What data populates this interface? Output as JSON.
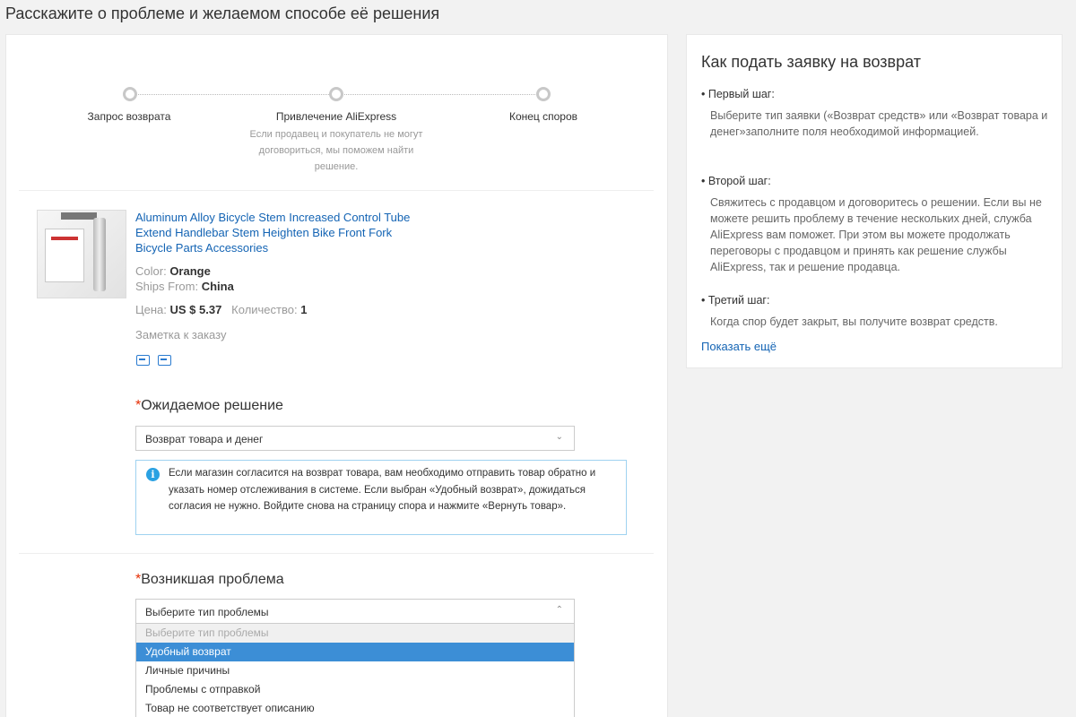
{
  "page": {
    "title": "Расскажите о проблеме и желаемом способе её решения"
  },
  "progress": {
    "steps": [
      {
        "label": "Запрос возврата",
        "desc": ""
      },
      {
        "label": "Привлечение AliExpress",
        "desc": "Если продавец и покупатель не могут договориться, мы поможем найти решение."
      },
      {
        "label": "Конец споров",
        "desc": ""
      }
    ]
  },
  "product": {
    "title": "Aluminum Alloy Bicycle Stem Increased Control Tube Extend Handlebar Stem Heighten Bike Front Fork Bicycle Parts Accessories",
    "color_label": "Color:",
    "color_value": "Orange",
    "ships_label": "Ships From:",
    "ships_value": "China",
    "price_label": "Цена:",
    "price_value": "US $ 5.37",
    "qty_label": "Количество:",
    "qty_value": "1",
    "note_label": "Заметка к заказу",
    "icons": [
      "shipping-icon",
      "order-card-icon"
    ]
  },
  "solution": {
    "required_mark": "*",
    "title": "Ожидаемое решение",
    "selected": "Возврат товара и денег",
    "info": "Если магазин согласится на возврат товара, вам необходимо отправить товар обратно и указать номер отслеживания в системе. Если выбран «Удобный возврат», дожидаться согласия не нужно. Войдите снова на страницу спора и нажмите «Вернуть товар»."
  },
  "problem": {
    "required_mark": "*",
    "title": "Возникшая проблема",
    "selected": "Выберите тип проблемы",
    "options": [
      "Выберите тип проблемы",
      "Удобный возврат",
      "Личные причины",
      "Проблемы с отправкой",
      "Товар не соответствует описанию"
    ]
  },
  "help": {
    "title": "Как подать заявку на возврат",
    "steps": [
      {
        "label": "• Первый шаг:",
        "text": "Выберите тип заявки («Возврат средств» или «Возврат товара и денег»заполните поля необходимой информацией."
      },
      {
        "label": "• Второй шаг:",
        "text": "Свяжитесь с продавцом и договоритесь о решении. Если вы не можете решить проблему в течение нескольких дней, служба AliExpress вам поможет. При этом вы можете продолжать переговоры с продавцом и принять как решение службы AliExpress, так и решение продавца."
      },
      {
        "label": "• Третий шаг:",
        "text": "Когда спор будет закрыт, вы получите возврат средств."
      }
    ],
    "show_more": "Показать ещё"
  },
  "colors": {
    "link": "#1464b4",
    "required": "#e62e04",
    "info_border": "#9fd2f0",
    "highlight": "#3c8ed6"
  }
}
